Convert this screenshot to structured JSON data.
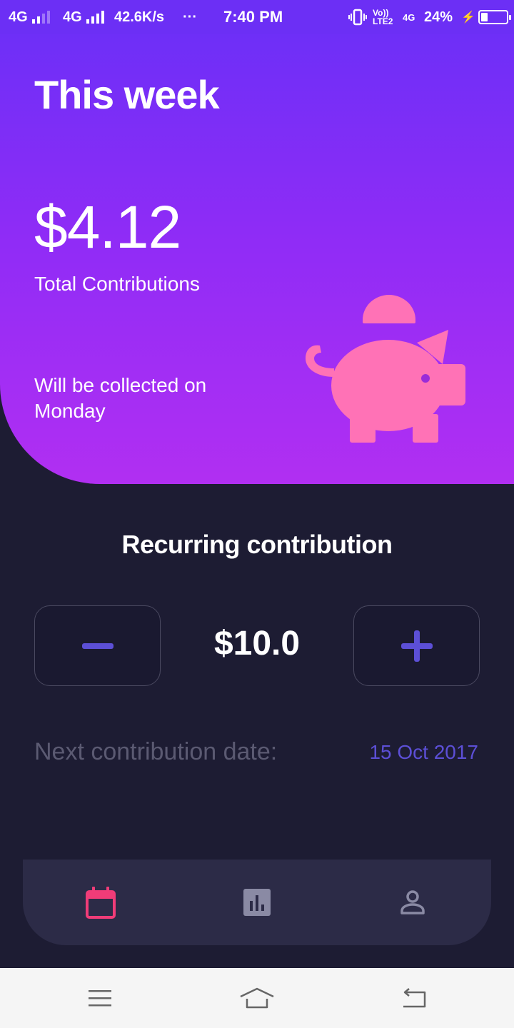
{
  "status_bar": {
    "network_1": "4G",
    "network_2": "4G",
    "speed": "42.6K/s",
    "more": "···",
    "time": "7:40 PM",
    "volte": "Vo))",
    "lte": "LTE2",
    "network_3": "4G",
    "battery": "24%"
  },
  "hero": {
    "title": "This week",
    "amount": "$4.12",
    "amount_label": "Total Contributions",
    "collect_text": "Will be collected on Monday",
    "illustration": "piggy-bank-icon"
  },
  "recurring": {
    "title": "Recurring contribution",
    "value": "$10.0",
    "decrement_icon": "minus-icon",
    "increment_icon": "plus-icon",
    "next_label": "Next contribution date:",
    "next_date": "15 Oct 2017"
  },
  "bottom_nav": {
    "items": [
      {
        "icon": "calendar-icon",
        "active": true
      },
      {
        "icon": "bar-chart-icon",
        "active": false
      },
      {
        "icon": "person-icon",
        "active": false
      }
    ]
  },
  "system_nav": {
    "items": [
      "menu-icon",
      "home-icon",
      "back-icon"
    ]
  },
  "colors": {
    "hero_top": "#6e2ff7",
    "hero_bottom": "#b12ff2",
    "background": "#1d1c33",
    "accent": "#5c4fd6",
    "piggy": "#ff72b6",
    "active_tab": "#f03c78",
    "nav_bar": "#2c2b47"
  }
}
